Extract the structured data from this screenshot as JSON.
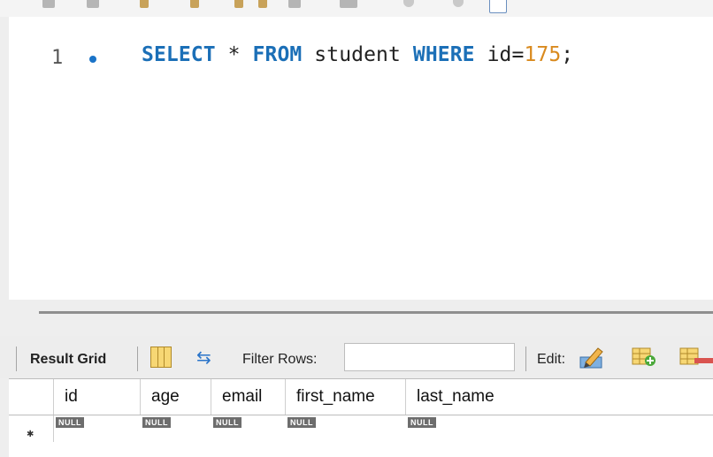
{
  "editor": {
    "line_number": "1",
    "code": {
      "kw1": "SELECT",
      "star": "*",
      "kw2": "FROM",
      "table": "student",
      "kw3": "WHERE",
      "cond": "id=",
      "value": "175",
      "semi": ";"
    }
  },
  "result_toolbar": {
    "result_grid_label": "Result Grid",
    "filter_label": "Filter Rows:",
    "filter_value": "",
    "edit_label": "Edit:"
  },
  "grid": {
    "columns": [
      "id",
      "age",
      "email",
      "first_name",
      "last_name"
    ],
    "new_row": {
      "marker": "✱",
      "values": [
        "NULL",
        "NULL",
        "NULL",
        "NULL",
        "NULL"
      ]
    }
  },
  "colors": {
    "keyword": "#1b6fb7",
    "number": "#d98a1e",
    "null_badge": "#6d6d6d"
  },
  "icons": [
    "grid-layout-icon",
    "refresh-icon",
    "edit-pencil-icon",
    "add-row-icon",
    "delete-row-icon"
  ]
}
